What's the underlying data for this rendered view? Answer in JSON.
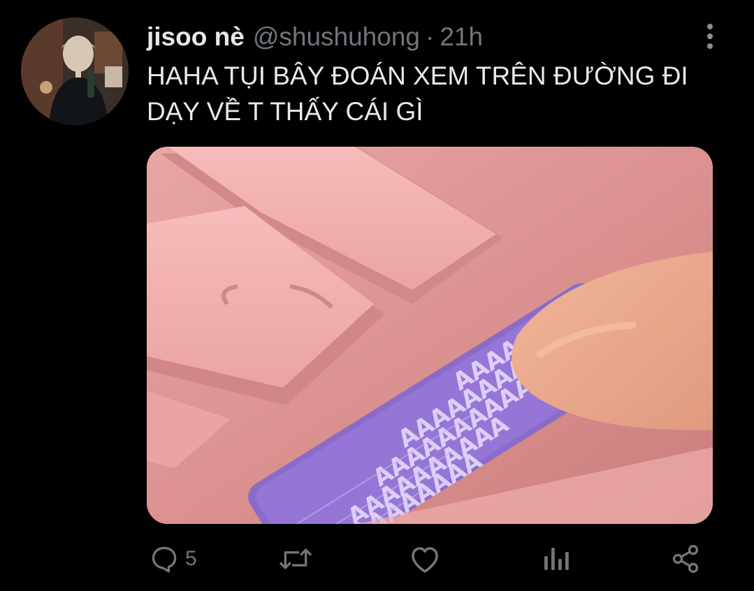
{
  "tweet": {
    "display_name": "jisoo nè",
    "handle": "@shushuhong",
    "separator": "·",
    "time": "21h",
    "text": "HAHA TỤI BÂY ĐOÁN XEM TRÊN ĐƯỜNG ĐI\nDẠY VỀ T THẤY CÁI GÌ"
  },
  "media": {
    "key_text_rows": [
      "AAAAA",
      "AAAAAAAA",
      "AAAAAAAAAA",
      "AAAAAAAAAA",
      "AAAAAAAAAA"
    ]
  },
  "actions": {
    "reply": {
      "icon": "reply-icon",
      "count": "5"
    },
    "retweet": {
      "icon": "retweet-icon",
      "count": ""
    },
    "like": {
      "icon": "heart-icon",
      "count": ""
    },
    "views": {
      "icon": "analytics-icon",
      "count": ""
    },
    "share": {
      "icon": "share-icon",
      "count": ""
    }
  },
  "colors": {
    "background": "#000000",
    "text": "#e7e9ea",
    "muted": "#71767b",
    "media_pink": "#e29c9b",
    "media_purple": "#8b6fd0"
  }
}
